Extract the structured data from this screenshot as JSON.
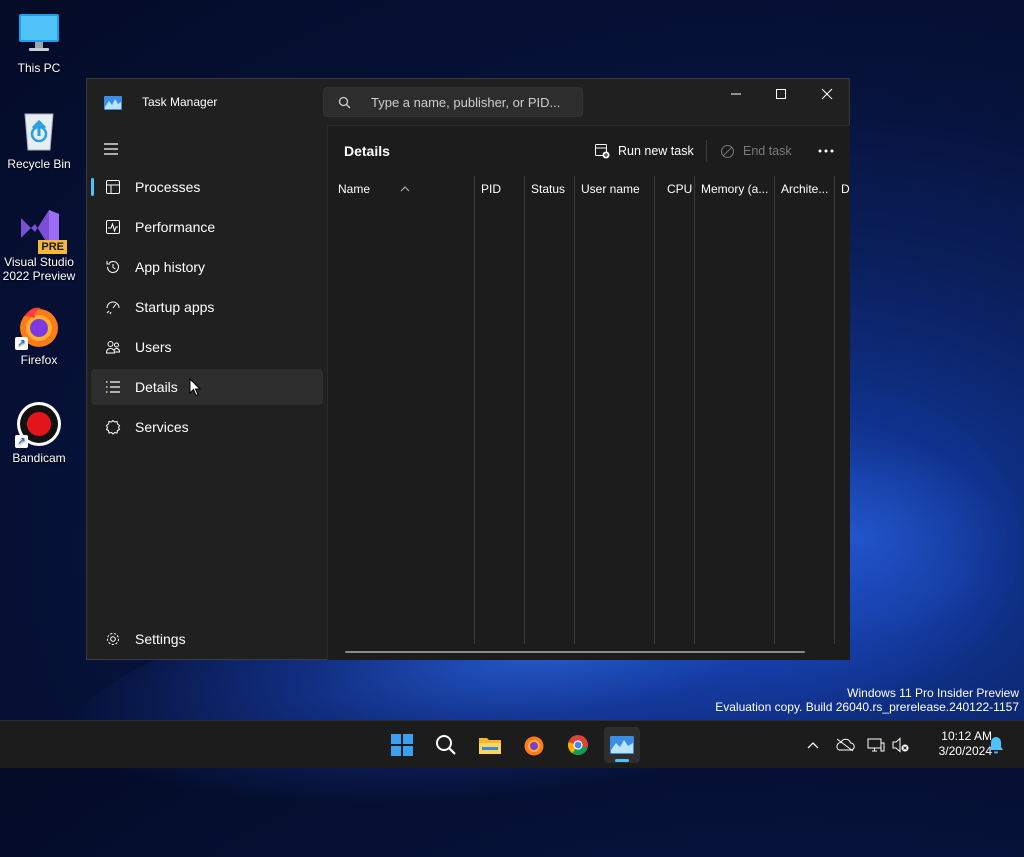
{
  "desktop": {
    "icons": [
      {
        "label": "This PC",
        "icon": "monitor-icon"
      },
      {
        "label": "Recycle Bin",
        "icon": "recycle-bin-icon"
      },
      {
        "label": "Visual Studio 2022 Preview",
        "icon": "visual-studio-icon",
        "badge": "PRE"
      },
      {
        "label": "Firefox",
        "icon": "firefox-icon"
      },
      {
        "label": "Bandicam",
        "icon": "bandicam-icon"
      }
    ],
    "watermark": {
      "line1": "Windows 11 Pro Insider Preview",
      "line2": "Evaluation copy. Build 26040.rs_prerelease.240122-1157"
    }
  },
  "window": {
    "title": "Task Manager",
    "search_placeholder": "Type a name, publisher, or PID...",
    "controls": [
      "minimize",
      "maximize",
      "close"
    ]
  },
  "nav": {
    "items": [
      {
        "label": "Processes",
        "icon": "processes-icon"
      },
      {
        "label": "Performance",
        "icon": "performance-icon"
      },
      {
        "label": "App history",
        "icon": "app-history-icon"
      },
      {
        "label": "Startup apps",
        "icon": "startup-apps-icon"
      },
      {
        "label": "Users",
        "icon": "users-icon"
      },
      {
        "label": "Details",
        "icon": "details-icon"
      },
      {
        "label": "Services",
        "icon": "services-icon"
      }
    ],
    "settings_label": "Settings"
  },
  "details": {
    "title": "Details",
    "run_new_task": "Run new task",
    "end_task": "End task",
    "columns": [
      "Name",
      "PID",
      "Status",
      "User name",
      "CPU",
      "Memory (a...",
      "Archite...",
      "De"
    ]
  },
  "taskbar": {
    "apps": [
      "start-icon",
      "search-icon",
      "file-explorer-icon",
      "firefox-icon",
      "chrome-icon",
      "task-manager-icon"
    ],
    "time": "10:12 AM",
    "date": "3/20/2024"
  },
  "colors": {
    "accent": "#4cc2ff",
    "window_bg": "#202020",
    "content_bg": "#1c1c1c"
  }
}
